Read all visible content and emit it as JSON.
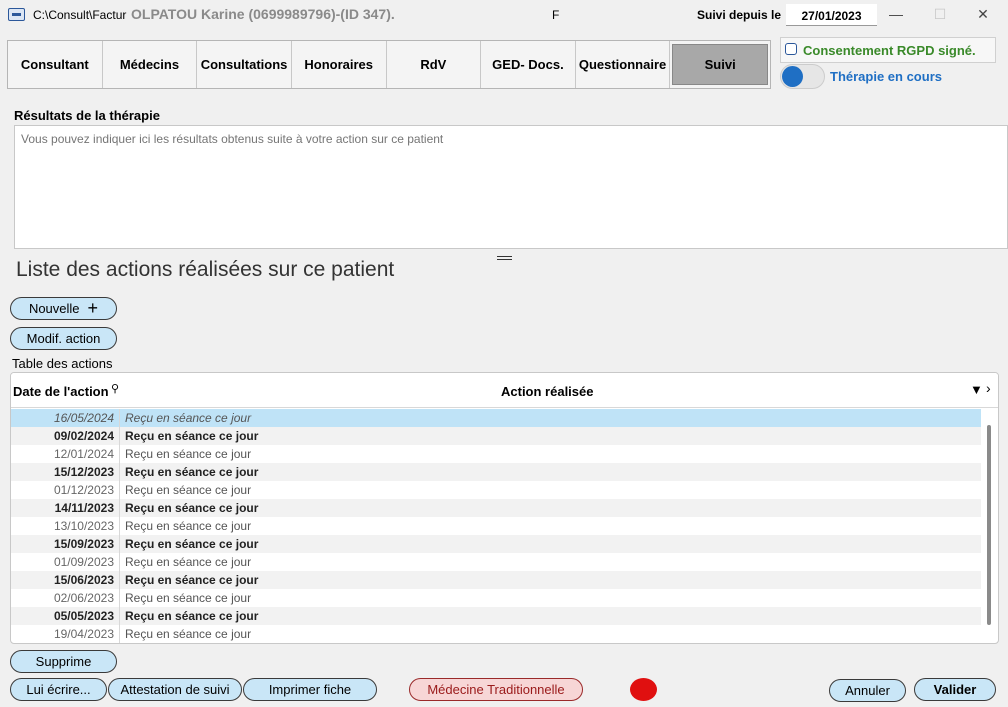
{
  "window": {
    "path": "C:\\Consult\\Factur",
    "patient": "OLPATOU Karine (0699989796)-(ID 347).",
    "sex": "F",
    "since_label": "Suivi depuis le",
    "since_date": "27/01/2023",
    "minimize": "—",
    "maximize": "☐",
    "close": "✕"
  },
  "tabs": [
    {
      "label": "Consultant"
    },
    {
      "label": "Médecins"
    },
    {
      "label": "Consultations"
    },
    {
      "label": "Honoraires"
    },
    {
      "label": "RdV"
    },
    {
      "label": "GED- Docs."
    },
    {
      "label": "Questionnaire"
    },
    {
      "label": "Suivi"
    }
  ],
  "active_tab": "Suivi",
  "rgpd_label": "Consentement RGPD signé.",
  "therapy_label": "Thérapie en cours",
  "results": {
    "label": "Résultats de la thérapie",
    "placeholder": "Vous pouvez indiquer ici les résultats obtenus suite à votre action sur ce patient"
  },
  "list_title": "Liste des actions réalisées sur ce patient",
  "buttons": {
    "new": "Nouvelle",
    "modify": "Modif. action",
    "delete": "Supprime",
    "write": "Lui écrire...",
    "attestation": "Attestation de suivi",
    "print": "Imprimer fiche",
    "traditional": "Médecine Traditionnelle",
    "cancel": "Annuler",
    "validate": "Valider"
  },
  "table": {
    "label": "Table des actions",
    "headers": {
      "date": "Date de l'action",
      "action": "Action réalisée"
    },
    "rows": [
      {
        "date": "16/05/2024",
        "action": "Reçu en séance ce jour",
        "selected": true,
        "bold": false
      },
      {
        "date": "09/02/2024",
        "action": "Reçu en séance ce jour",
        "selected": false,
        "bold": true
      },
      {
        "date": "12/01/2024",
        "action": "Reçu en séance ce jour",
        "selected": false,
        "bold": false
      },
      {
        "date": "15/12/2023",
        "action": "Reçu en séance ce jour",
        "selected": false,
        "bold": true
      },
      {
        "date": "01/12/2023",
        "action": "Reçu en séance ce jour",
        "selected": false,
        "bold": false
      },
      {
        "date": "14/11/2023",
        "action": "Reçu en séance ce jour",
        "selected": false,
        "bold": true
      },
      {
        "date": "13/10/2023",
        "action": "Reçu en séance ce jour",
        "selected": false,
        "bold": false
      },
      {
        "date": "15/09/2023",
        "action": "Reçu en séance ce jour",
        "selected": false,
        "bold": true
      },
      {
        "date": "01/09/2023",
        "action": "Reçu en séance ce jour",
        "selected": false,
        "bold": false
      },
      {
        "date": "15/06/2023",
        "action": "Reçu en séance ce jour",
        "selected": false,
        "bold": true
      },
      {
        "date": "02/06/2023",
        "action": "Reçu en séance ce jour",
        "selected": false,
        "bold": false
      },
      {
        "date": "05/05/2023",
        "action": "Reçu en séance ce jour",
        "selected": false,
        "bold": true
      },
      {
        "date": "19/04/2023",
        "action": "Reçu en séance ce jour",
        "selected": false,
        "bold": false
      }
    ]
  },
  "colors": {
    "accent": "#1f6fc4",
    "rgpd_green": "#3a8a2a",
    "button_fill": "#c9e6f7",
    "selected_row": "#bfe3f7",
    "status_red": "#e01010"
  }
}
